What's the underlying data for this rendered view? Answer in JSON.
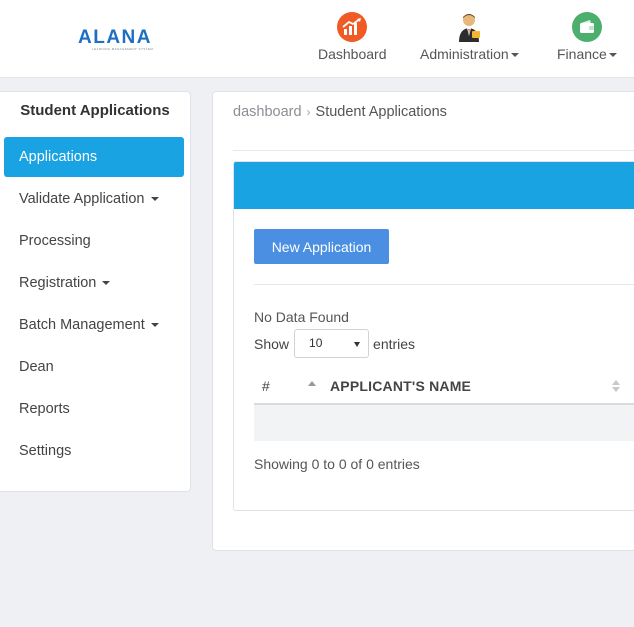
{
  "header": {
    "logo_text": "ALANA",
    "logo_subtext": "LEARNING MANAGEMENT SYSTEM",
    "nav": [
      {
        "label": "Dashboard",
        "icon": "chart-growth-icon",
        "has_caret": false
      },
      {
        "label": "Administration",
        "icon": "businessman-icon",
        "has_caret": true
      },
      {
        "label": "Finance",
        "icon": "wallet-icon",
        "has_caret": true
      }
    ]
  },
  "sidebar": {
    "title": "Student Applications",
    "items": [
      {
        "label": "Applications",
        "active": true
      },
      {
        "label": "Validate Application"
      },
      {
        "label": "Processing"
      },
      {
        "label": "Registration"
      },
      {
        "label": "Batch Management"
      },
      {
        "label": "Dean"
      },
      {
        "label": "Reports"
      },
      {
        "label": "Settings"
      }
    ]
  },
  "breadcrumb": {
    "parent": "dashboard",
    "current": "Student Applications"
  },
  "main": {
    "new_button_label": "New Application",
    "no_data_text": "No Data Found",
    "show_label": "Show",
    "entries_value": "10",
    "entries_label": "entries",
    "columns": [
      "#",
      "APPLICANT'S NAME"
    ],
    "info_text": "Showing 0 to 0 of 0 entries"
  },
  "colors": {
    "accent": "#1aa3e2",
    "button": "#4a8fe2",
    "dashboard_icon": "#f05a24",
    "finance_icon": "#4caf6e"
  }
}
